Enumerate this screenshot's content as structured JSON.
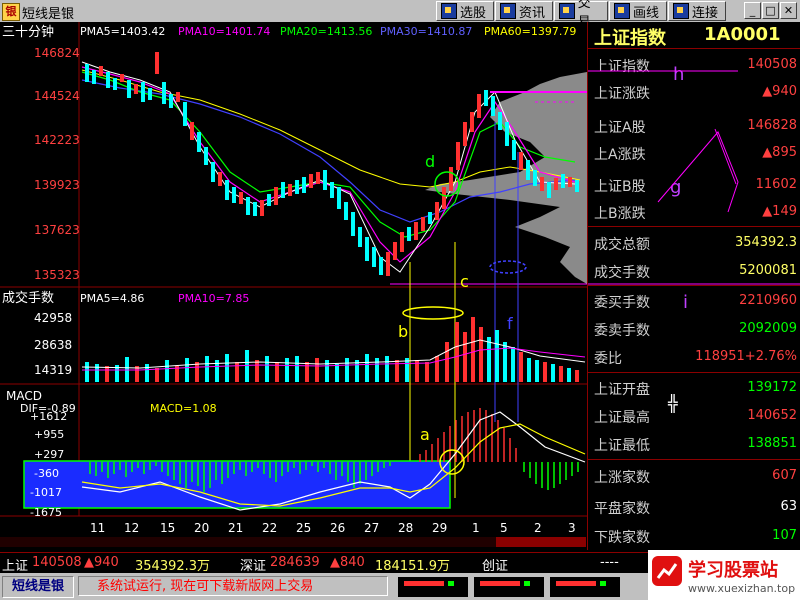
{
  "app": {
    "title": "短线是银"
  },
  "toolbar": {
    "pick": "选股",
    "news": "资讯",
    "trade": "交易",
    "draw": "画线",
    "connect": "连接"
  },
  "chart": {
    "period": "三十分钟",
    "ma": [
      {
        "label": "PMA5=1403.42",
        "color": "#ffffff"
      },
      {
        "label": "PMA10=1401.74",
        "color": "#ff00ff"
      },
      {
        "label": "PMA20=1413.56",
        "color": "#00ff00"
      },
      {
        "label": "PMA30=1410.87",
        "color": "#4040ff"
      },
      {
        "label": "PMA60=1397.79",
        "color": "#ffff00"
      }
    ],
    "price_ticks": [
      "146824",
      "144524",
      "142223",
      "139923",
      "137623",
      "135323"
    ],
    "vol_title": "成交手数",
    "vol_ma5": "PMA5=4.86",
    "vol_ma10": "PMA10=7.85",
    "vol_ticks": [
      "42958",
      "28638",
      "14319"
    ],
    "macd_title": "MACD",
    "dif": "DIF=-0.89",
    "macd": "MACD=1.08",
    "macd_ticks": [
      "+1612",
      "+955",
      "+297",
      "-360",
      "-1017",
      "-1675"
    ],
    "x_ticks": [
      "11",
      "12",
      "15",
      "20",
      "21",
      "22",
      "25",
      "26",
      "27",
      "28",
      "29",
      "1",
      "5",
      "2",
      "3"
    ],
    "annotations": [
      "a",
      "b",
      "c",
      "d",
      "f",
      "g",
      "h",
      "i"
    ]
  },
  "panel": {
    "title": "上证指数",
    "code": "1A0001",
    "rows": [
      {
        "label": "上证指数",
        "value": "140508",
        "color": "#ff4040"
      },
      {
        "label": "上证涨跌",
        "value": "▲940",
        "color": "#ff4040"
      },
      {
        "label": "上证A股",
        "value": "146828",
        "color": "#ff4040"
      },
      {
        "label": "上A涨跌",
        "value": "▲895",
        "color": "#ff4040"
      },
      {
        "label": "上证B股",
        "value": "11602",
        "color": "#ff4040"
      },
      {
        "label": "上B涨跌",
        "value": "▲149",
        "color": "#ff4040"
      },
      {
        "label": "成交总额",
        "value": "354392.3",
        "color": "#ffff66"
      },
      {
        "label": "成交手数",
        "value": "5200081",
        "color": "#ffff66"
      },
      {
        "label": "委买手数",
        "value": "2210960",
        "color": "#ff4040"
      },
      {
        "label": "委卖手数",
        "value": "2092009",
        "color": "#00ff00"
      },
      {
        "label": "委比",
        "value": "118951+2.76%",
        "color": "#ff4040"
      },
      {
        "label": "上证开盘",
        "value": "139172",
        "color": "#00ff00"
      },
      {
        "label": "上证最高",
        "value": "140652",
        "color": "#ff4040"
      },
      {
        "label": "上证最低",
        "value": "138851",
        "color": "#00ff00"
      },
      {
        "label": "上涨家数",
        "value": "607",
        "color": "#ff4040"
      },
      {
        "label": "平盘家数",
        "value": "63",
        "color": "#ffffff"
      },
      {
        "label": "下跌家数",
        "value": "107",
        "color": "#00ff00"
      }
    ]
  },
  "ticker": {
    "sh_name": "上证",
    "sh_val": "140508",
    "sh_chg": "▲940",
    "sh_amt": "354392.3万",
    "sz_name": "深证",
    "sz_val": "284639",
    "sz_chg": "▲840",
    "sz_amt": "184151.9万",
    "cy_name": "创证",
    "cy_val": "----"
  },
  "status": {
    "app": "短线是银",
    "message": "系统试运行, 现在可下载新版网上交易"
  },
  "watermark": {
    "site": "学习股票站",
    "url": "www.xuexizhan.top"
  }
}
